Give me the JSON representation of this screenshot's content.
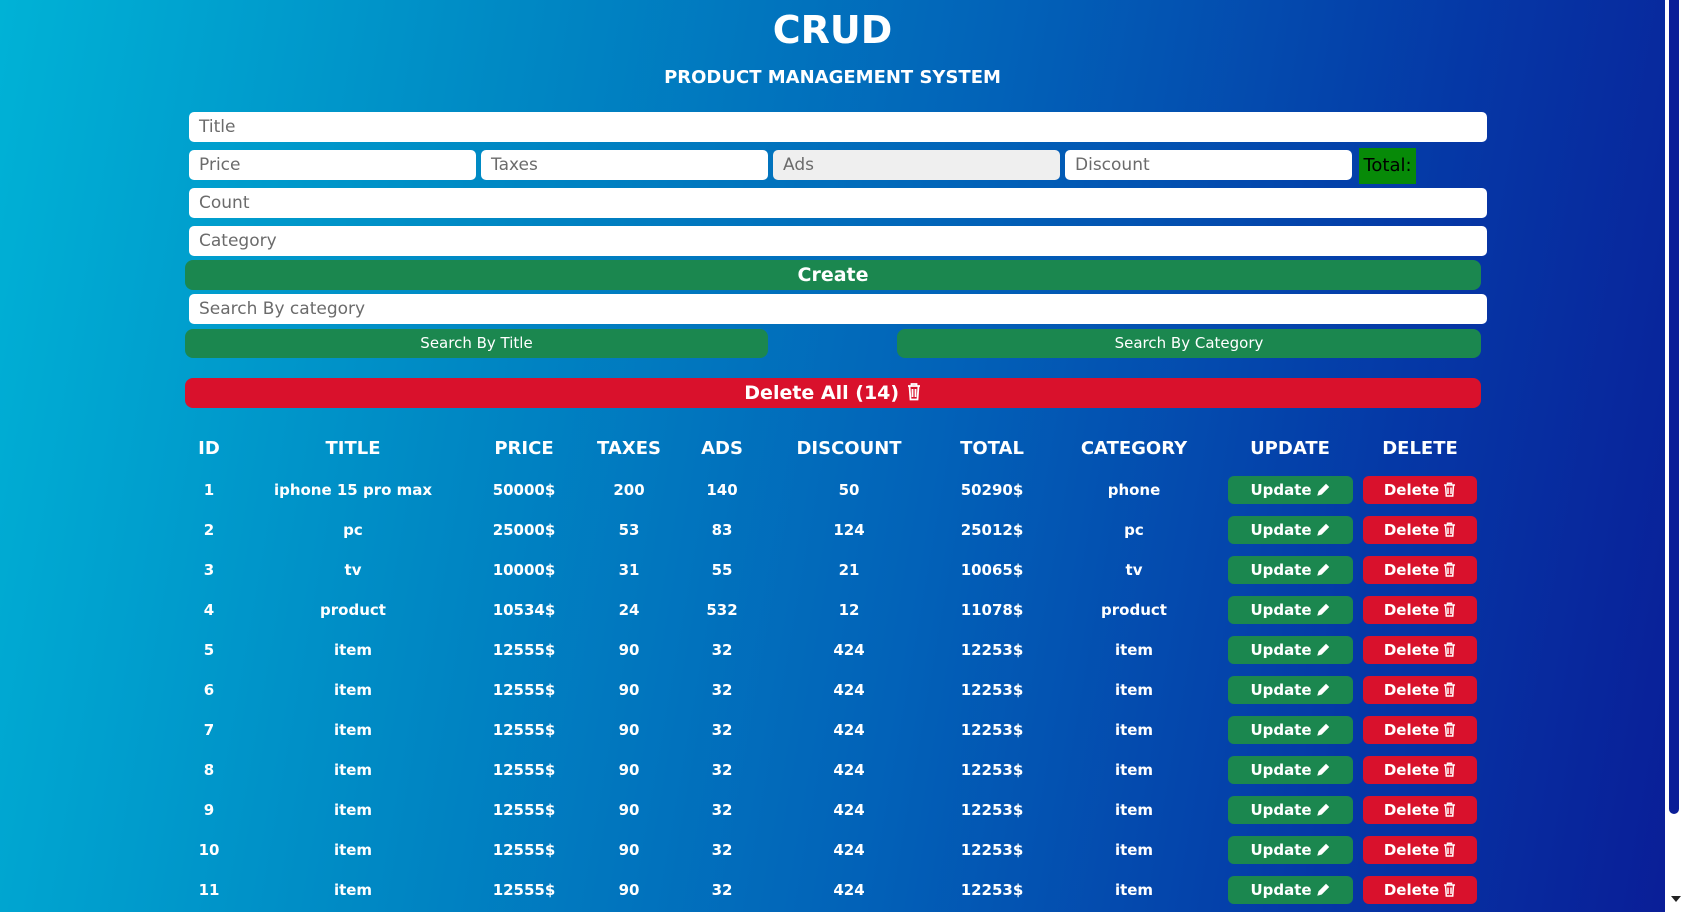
{
  "header": {
    "title": "CRUD",
    "subtitle": "PRODUCT MANAGEMENT SYSTEM"
  },
  "form": {
    "title_placeholder": "Title",
    "price_placeholder": "Price",
    "taxes_placeholder": "Taxes",
    "ads_placeholder": "Ads",
    "discount_placeholder": "Discount",
    "total_label": "Total:",
    "count_placeholder": "Count",
    "category_placeholder": "Category",
    "create_label": "Create"
  },
  "search": {
    "placeholder": "Search By category",
    "by_title_label": "Search By Title",
    "by_category_label": "Search By Category"
  },
  "delete_all": {
    "label": "Delete All (14)"
  },
  "table": {
    "headers": [
      "ID",
      "TITLE",
      "PRICE",
      "TAXES",
      "ADS",
      "DISCOUNT",
      "TOTAL",
      "CATEGORY",
      "UPDATE",
      "DELETE"
    ],
    "update_label": "Update",
    "delete_label": "Delete",
    "rows": [
      {
        "id": "1",
        "title": "iphone 15 pro max",
        "price": "50000$",
        "taxes": "200",
        "ads": "140",
        "discount": "50",
        "total": "50290$",
        "category": "phone"
      },
      {
        "id": "2",
        "title": "pc",
        "price": "25000$",
        "taxes": "53",
        "ads": "83",
        "discount": "124",
        "total": "25012$",
        "category": "pc"
      },
      {
        "id": "3",
        "title": "tv",
        "price": "10000$",
        "taxes": "31",
        "ads": "55",
        "discount": "21",
        "total": "10065$",
        "category": "tv"
      },
      {
        "id": "4",
        "title": "product",
        "price": "10534$",
        "taxes": "24",
        "ads": "532",
        "discount": "12",
        "total": "11078$",
        "category": "product"
      },
      {
        "id": "5",
        "title": "item",
        "price": "12555$",
        "taxes": "90",
        "ads": "32",
        "discount": "424",
        "total": "12253$",
        "category": "item"
      },
      {
        "id": "6",
        "title": "item",
        "price": "12555$",
        "taxes": "90",
        "ads": "32",
        "discount": "424",
        "total": "12253$",
        "category": "item"
      },
      {
        "id": "7",
        "title": "item",
        "price": "12555$",
        "taxes": "90",
        "ads": "32",
        "discount": "424",
        "total": "12253$",
        "category": "item"
      },
      {
        "id": "8",
        "title": "item",
        "price": "12555$",
        "taxes": "90",
        "ads": "32",
        "discount": "424",
        "total": "12253$",
        "category": "item"
      },
      {
        "id": "9",
        "title": "item",
        "price": "12555$",
        "taxes": "90",
        "ads": "32",
        "discount": "424",
        "total": "12253$",
        "category": "item"
      },
      {
        "id": "10",
        "title": "item",
        "price": "12555$",
        "taxes": "90",
        "ads": "32",
        "discount": "424",
        "total": "12253$",
        "category": "item"
      },
      {
        "id": "11",
        "title": "item",
        "price": "12555$",
        "taxes": "90",
        "ads": "32",
        "discount": "424",
        "total": "12253$",
        "category": "item"
      }
    ]
  },
  "colors": {
    "create_green": "#1b874f",
    "delete_red": "#d9112c",
    "total_green": "#078a08"
  },
  "icons": {
    "update": "pencil-icon",
    "delete": "trash-icon"
  }
}
